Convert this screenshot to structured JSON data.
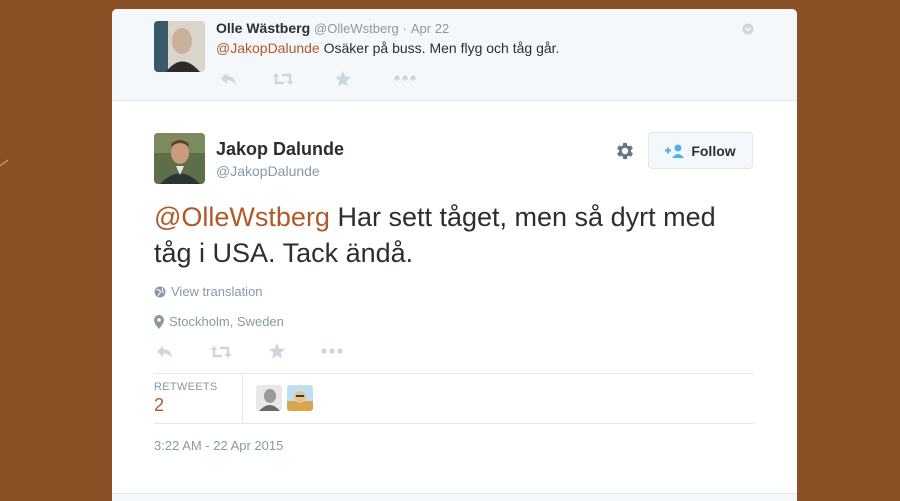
{
  "parent_tweet": {
    "name": "Olle Wästberg",
    "handle": "@OlleWstberg",
    "dot": "·",
    "time": "Apr 22",
    "mention": "@JakopDalunde",
    "text": " Osäker på buss. Men flyg och tåg går."
  },
  "main_tweet": {
    "name": "Jakop Dalunde",
    "handle": "@JakopDalunde",
    "follow_label": "Follow",
    "mention": "@OlleWstberg",
    "text": " Har sett tåget, men så dyrt med tåg i USA. Tack ändå.",
    "view_translation": "View translation",
    "location": "Stockholm, Sweden",
    "retweets_label": "RETWEETS",
    "retweets_count": "2",
    "timestamp": "3:22 AM - 22 Apr 2015"
  },
  "icons": [
    "reply-icon",
    "retweet-icon",
    "favorite-icon",
    "more-icon",
    "gear-icon",
    "follow-person-icon",
    "globe-icon",
    "location-pin-icon",
    "caret-icon"
  ],
  "colors": {
    "background": "#8a5127",
    "link": "#b05a29",
    "muted": "#8899a6",
    "text": "#292f33"
  }
}
